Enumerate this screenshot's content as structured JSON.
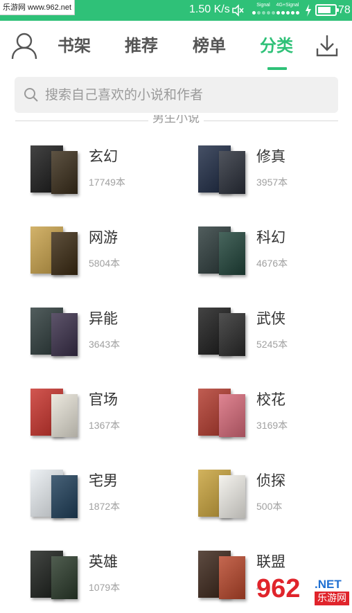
{
  "status_bar": {
    "watermark": "乐游网 www.962.net",
    "net_speed": "1.50 K/s",
    "signal1_label": "Signal",
    "signal2_label": "4G+Signal",
    "battery_level": "78",
    "battery_fraction": 0.78
  },
  "header": {
    "tabs": [
      {
        "label": "书架"
      },
      {
        "label": "推荐"
      },
      {
        "label": "榜单"
      },
      {
        "label": "分类"
      }
    ],
    "active_tab": "分类",
    "accent_color": "#2fc178"
  },
  "search": {
    "placeholder": "搜索自己喜欢的小说和作者"
  },
  "section": {
    "title": "男生小说"
  },
  "categories": [
    {
      "name": "玄幻",
      "count": "17749本",
      "colors": [
        "#1a1a1a",
        "#3a2d1a"
      ]
    },
    {
      "name": "修真",
      "count": "3957本",
      "colors": [
        "#1d2a44",
        "#2a2f3a"
      ]
    },
    {
      "name": "网游",
      "count": "5804本",
      "colors": [
        "#c9a24a",
        "#3b2a12"
      ]
    },
    {
      "name": "科幻",
      "count": "4676本",
      "colors": [
        "#2b3a3a",
        "#20443a"
      ]
    },
    {
      "name": "异能",
      "count": "3643本",
      "colors": [
        "#2c3a3a",
        "#3a2f4a"
      ]
    },
    {
      "name": "武侠",
      "count": "5245本",
      "colors": [
        "#1a1a1a",
        "#2a2a2a"
      ]
    },
    {
      "name": "官场",
      "count": "1367本",
      "colors": [
        "#c8312a",
        "#e8e4d8"
      ]
    },
    {
      "name": "校花",
      "count": "3169本",
      "colors": [
        "#b2392c",
        "#d86a7a"
      ]
    },
    {
      "name": "宅男",
      "count": "1872本",
      "colors": [
        "#e9eef2",
        "#1f3f5a"
      ]
    },
    {
      "name": "侦探",
      "count": "500本",
      "colors": [
        "#c8a23a",
        "#f2f0ea"
      ]
    },
    {
      "name": "英雄",
      "count": "1079本",
      "colors": [
        "#1a1e1a",
        "#2a3a2a"
      ]
    },
    {
      "name": "联盟",
      "count": "4…",
      "colors": [
        "#3a2418",
        "#b8462a"
      ]
    }
  ],
  "footer_watermark": {
    "logo": "962",
    "domain": ".NET",
    "name": "乐游网"
  },
  "icons": {
    "avatar": "user-avatar-icon",
    "download": "download-icon",
    "search": "search-icon",
    "mute": "mute-icon",
    "charge": "charging-icon"
  }
}
